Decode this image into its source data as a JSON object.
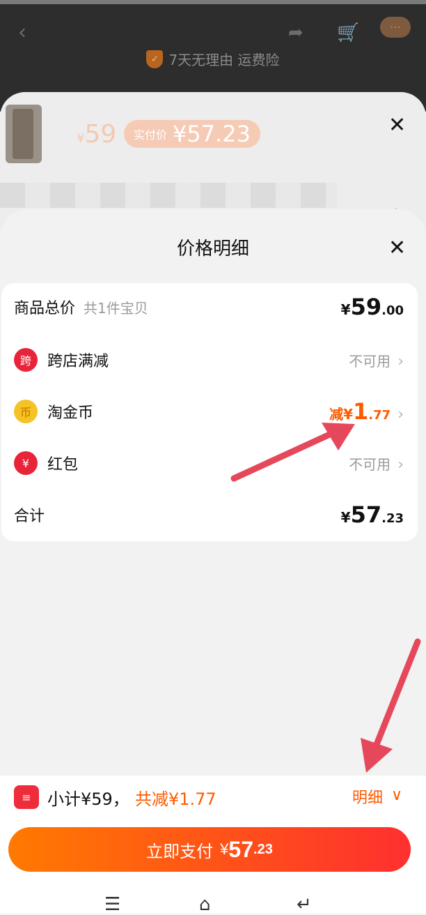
{
  "header": {
    "guarantee_text": "7天无理由 运费险",
    "icons": [
      "back-icon",
      "share-icon",
      "cart-icon",
      "more-icon",
      "shield-icon"
    ]
  },
  "product": {
    "price_currency": "¥",
    "price": "59",
    "real_price_label": "实付价",
    "real_price": "¥57.23"
  },
  "detail_sheet": {
    "title": "价格明细",
    "rows": [
      {
        "label": "商品总价",
        "sub": "共1件宝贝",
        "value_currency": "¥",
        "value_int": "59",
        "value_dec": ".00"
      },
      {
        "label": "跨店满减",
        "icon_char": "跨",
        "status": "不可用"
      },
      {
        "label": "淘金币",
        "icon_char": "币",
        "discount_prefix": "减¥",
        "discount_int": "1",
        "discount_dec": ".77"
      },
      {
        "label": "红包",
        "icon_char": "¥",
        "status": "不可用"
      },
      {
        "label": "合计",
        "value_currency": "¥",
        "value_int": "57",
        "value_dec": ".23"
      }
    ]
  },
  "bottom_bar": {
    "subtotal": "小计¥59，",
    "total_saved": "共减¥1.77",
    "detail_link": "明细",
    "pay_button": {
      "label": "立即支付",
      "currency": "¥",
      "int": "57",
      "dec": ".23"
    }
  },
  "colors": {
    "accent": "#ff5a00",
    "red": "#e8243a",
    "arrow": "#e5485a"
  }
}
